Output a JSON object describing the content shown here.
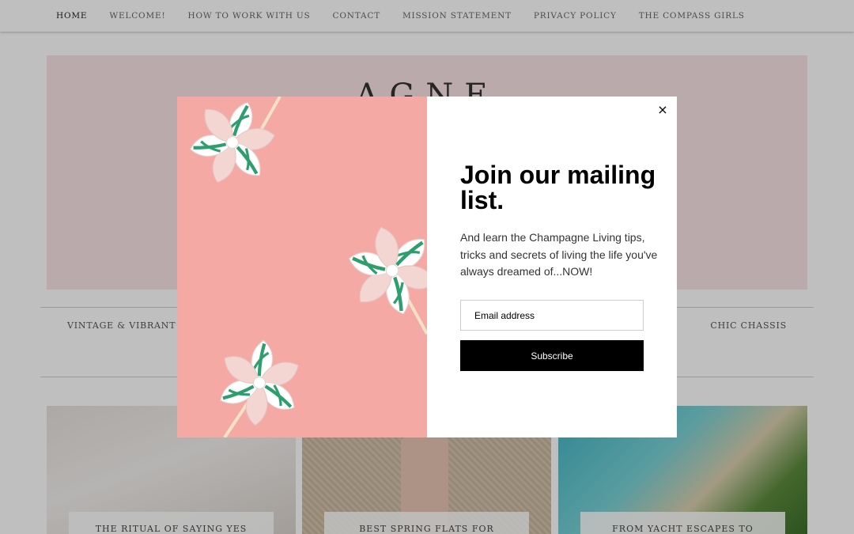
{
  "nav": {
    "items": [
      {
        "label": "HOME"
      },
      {
        "label": "WELCOME!"
      },
      {
        "label": "HOW TO WORK WITH US"
      },
      {
        "label": "CONTACT"
      },
      {
        "label": "MISSION STATEMENT"
      },
      {
        "label": "PRIVACY POLICY"
      },
      {
        "label": "THE COMPASS GIRLS"
      }
    ]
  },
  "hero": {
    "logo_fragment": "AGNE"
  },
  "categories": {
    "left": "VINTAGE & VIBRANT",
    "right": "CHIC CHASSIS"
  },
  "posts": [
    {
      "title": "THE RITUAL OF SAYING YES"
    },
    {
      "title": "BEST SPRING FLATS FOR"
    },
    {
      "title": "FROM YACHT ESCAPES TO"
    }
  ],
  "popup": {
    "close_label": "×",
    "heading": "Join our mailing list.",
    "body": "And learn the Champagne Living tips, tricks and secrets of living the life you've always dreamed of...NOW!",
    "email_placeholder": "Email address",
    "subscribe_label": "Subscribe",
    "image_icon": "pinwheel-photo"
  },
  "colors": {
    "hero_bg": "#f9e3e4",
    "popup_image_bg": "#f5a9a4",
    "subscribe_bg": "#000000",
    "pinwheel_green": "#2f9e6e"
  }
}
